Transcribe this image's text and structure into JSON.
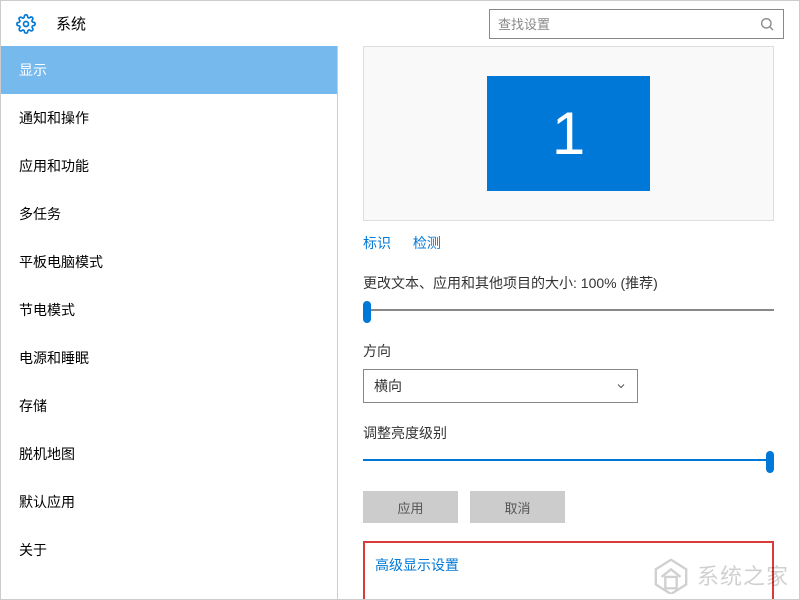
{
  "header": {
    "title": "系统",
    "search_placeholder": "查找设置"
  },
  "sidebar": {
    "items": [
      "显示",
      "通知和操作",
      "应用和功能",
      "多任务",
      "平板电脑模式",
      "节电模式",
      "电源和睡眠",
      "存储",
      "脱机地图",
      "默认应用",
      "关于"
    ],
    "active_index": 0
  },
  "main": {
    "monitor_number": "1",
    "link_identify": "标识",
    "link_detect": "检测",
    "scaling_label": "更改文本、应用和其他项目的大小: 100% (推荐)",
    "orientation_label": "方向",
    "orientation_value": "横向",
    "brightness_label": "调整亮度级别",
    "btn_apply": "应用",
    "btn_cancel": "取消",
    "advanced_link": "高级显示设置"
  },
  "watermark": {
    "text": "系统之家"
  }
}
